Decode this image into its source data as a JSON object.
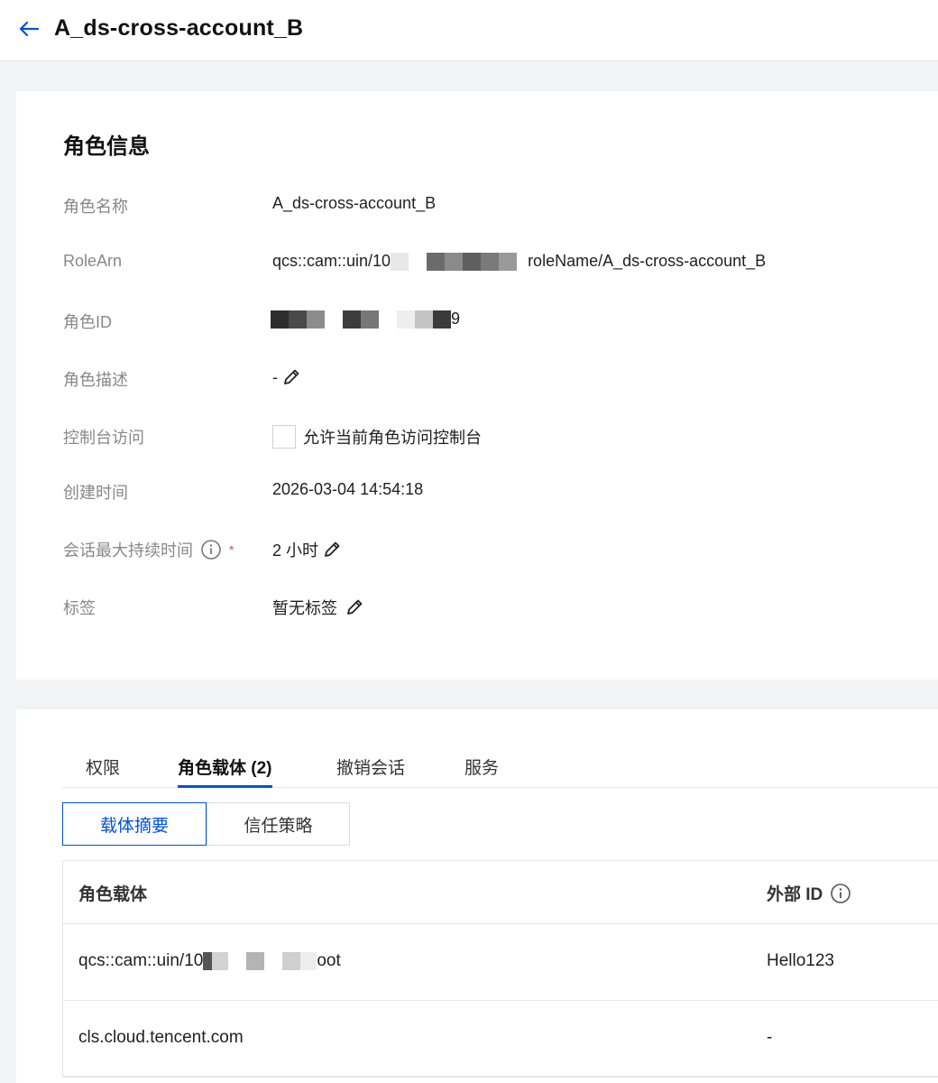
{
  "header": {
    "title": "A_ds-cross-account_B"
  },
  "role_info": {
    "section_title": "角色信息",
    "fields": {
      "role_name": {
        "label": "角色名称",
        "value": "A_ds-cross-account_B"
      },
      "role_arn": {
        "label": "RoleArn",
        "prefix": "qcs::cam::uin/10",
        "suffix": "roleName/A_ds-cross-account_B"
      },
      "role_id": {
        "label": "角色ID",
        "suffix": "9"
      },
      "description": {
        "label": "角色描述",
        "value": "-"
      },
      "console_access": {
        "label": "控制台访问",
        "checkbox_label": "允许当前角色访问控制台",
        "checked": false
      },
      "created_at": {
        "label": "创建时间",
        "value": "2026-03-04 14:54:18"
      },
      "max_session": {
        "label": "会话最大持续时间",
        "required_mark": "*",
        "value": "2 小时"
      },
      "tags": {
        "label": "标签",
        "value": "暂无标签"
      }
    }
  },
  "tabs": [
    {
      "label": "权限",
      "active": false
    },
    {
      "label": "角色载体 (2)",
      "active": true
    },
    {
      "label": "撤销会话",
      "active": false
    },
    {
      "label": "服务",
      "active": false
    }
  ],
  "segments": [
    {
      "label": "载体摘要",
      "active": true
    },
    {
      "label": "信任策略",
      "active": false
    }
  ],
  "carrier_table": {
    "columns": [
      "角色载体",
      "外部 ID"
    ],
    "rows": [
      {
        "carrier_prefix": "qcs::cam::uin/10",
        "carrier_suffix": "oot",
        "external_id": "Hello123"
      },
      {
        "carrier": "cls.cloud.tencent.com",
        "external_id": "-"
      }
    ]
  },
  "colors": {
    "accent": "#0052d9",
    "required": "#e54545",
    "label_gray": "#888888",
    "background": "#f2f3f5"
  }
}
